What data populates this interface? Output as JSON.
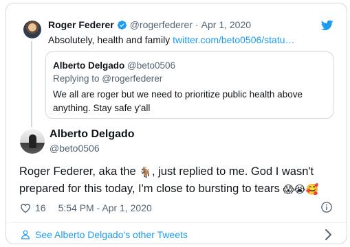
{
  "parent_tweet": {
    "author_name": "Roger Federer",
    "author_handle": "@rogerfederer",
    "separator": "·",
    "date": "Apr 1, 2020",
    "text": "Absolutely, health and family",
    "link": "twitter.com/beto0506/statu…",
    "quoted_tweet": {
      "author_name": "Alberto Delgado",
      "author_handle": "@beto0506",
      "replying_to": "Replying to @rogerfederer",
      "text": "We all are roger but we need to prioritize public health above anything. Stay safe y'all"
    }
  },
  "main_tweet": {
    "author_name": "Alberto Delgado",
    "author_handle": "@beto0506",
    "text_part1": "Roger Federer, aka the ",
    "goat_emoji": "🐐",
    "text_part2": ", just replied to me. God I wasn't prepared for this today, I'm close to bursting to tears ",
    "trailing_emojis": "😱😭🥰",
    "likes": "16",
    "timestamp": "5:54 PM - Apr 1, 2020"
  },
  "footer": {
    "link_text": "See Alberto Delgado's other Tweets"
  },
  "icons": {
    "verified": "verified-badge-icon",
    "twitter": "twitter-bird-icon",
    "heart": "heart-icon",
    "info": "info-icon",
    "person": "person-icon",
    "chevron": "chevron-right-icon"
  },
  "colors": {
    "accent": "#1d9bf0",
    "text": "#0f1419",
    "muted": "#536471",
    "border": "#cfd9de"
  }
}
